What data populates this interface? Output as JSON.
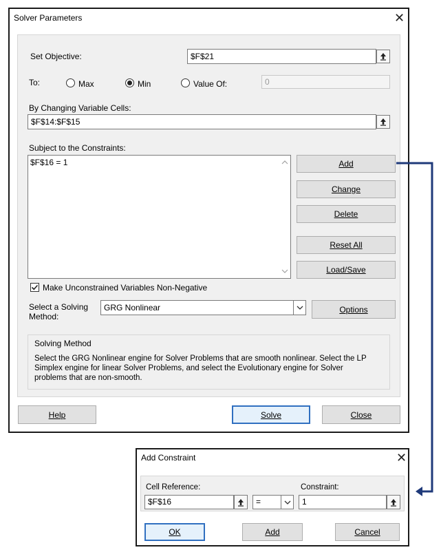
{
  "solver": {
    "title": "Solver Parameters",
    "set_objective_label": "Set Objective:",
    "objective_value": "$F$21",
    "to_label": "To:",
    "max_label": "Max",
    "min_label": "Min",
    "value_of_label": "Value Of:",
    "value_of_value": "0",
    "selected_target": "Min",
    "changing_cells_label": "By Changing Variable Cells:",
    "changing_cells_value": "$F$14:$F$15",
    "constraints_label": "Subject to the Constraints:",
    "constraints": [
      "$F$16 = 1"
    ],
    "buttons": {
      "add": "Add",
      "change": "Change",
      "delete": "Delete",
      "reset_all": "Reset All",
      "load_save": "Load/Save",
      "options": "Options",
      "help": "Help",
      "solve": "Solve",
      "close": "Close"
    },
    "nonnegative_label": "Make Unconstrained Variables Non-Negative",
    "nonnegative_checked": true,
    "method_label_line1": "Select a Solving",
    "method_label_line2": "Method:",
    "method_value": "GRG Nonlinear",
    "solving_method_heading": "Solving Method",
    "solving_method_desc_1": "Select the GRG Nonlinear engine for Solver Problems that are smooth nonlinear. Select the LP",
    "solving_method_desc_2": "Simplex engine for linear Solver Problems, and select the Evolutionary engine for Solver",
    "solving_method_desc_3": "problems that are non-smooth."
  },
  "add_constraint": {
    "title": "Add Constraint",
    "cell_reference_label": "Cell Reference:",
    "cell_reference_value": "$F$16",
    "operator_value": "=",
    "constraint_label": "Constraint:",
    "constraint_value": "1",
    "ok": "OK",
    "add": "Add",
    "cancel": "Cancel"
  },
  "colors": {
    "arrow": "#1f3a7a",
    "default_button_border": "#2f6fc0",
    "panel_bg": "#f0f0f0"
  },
  "icons": [
    "close-icon",
    "collapse-dialog-icon",
    "scroll-up-icon",
    "scroll-down-icon",
    "dropdown-arrow-icon",
    "checkmark-icon"
  ]
}
